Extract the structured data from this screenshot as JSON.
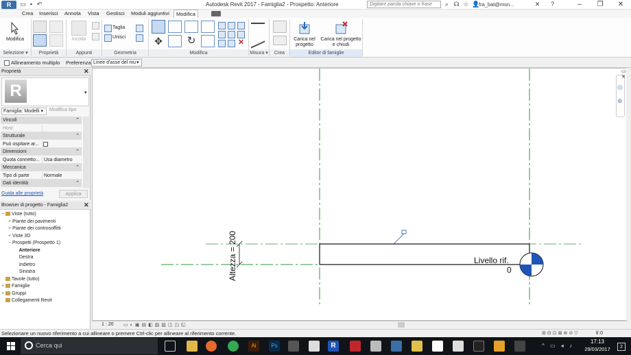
{
  "titlebar": {
    "app_letter": "R",
    "title": "Autodesk Revit 2017 -    Famiglia2 - Prospetto: Anteriore",
    "search_placeholder": "Digitare parola chiave o frase",
    "user": "fra_bat@msn...",
    "help": "?"
  },
  "tabs": [
    "Crea",
    "Inserisci",
    "Annota",
    "Vista",
    "Gestisci",
    "Moduli aggiuntivi",
    "Modifica"
  ],
  "active_tab": "Modifica",
  "ribbon": {
    "modifica": "Modifica",
    "incolla": "Incolla",
    "taglia": "Taglia",
    "unisci": "Unisci",
    "carica_progetto": "Carica nel progetto",
    "carica_chiudi": "Carica nel progetto e chiudi",
    "panels": {
      "selezione": "Selezione",
      "proprieta": "Proprietà",
      "appunti": "Appunti",
      "geometria": "Geometria",
      "modifica": "Modifica",
      "misura": "Misura",
      "crea": "Crea",
      "editor": "Editor di famiglie"
    }
  },
  "optionbar": {
    "allineamento": "Allineamento multiplo",
    "preferenza_label": "Preferenza:",
    "preferenza_value": "Linee d'asse del mu"
  },
  "properties": {
    "title": "Proprietà",
    "type_selector": "Famiglia: Modelli",
    "modifica_tipo": "Modifica tipo",
    "rows": [
      {
        "cat": true,
        "name": "Vincoli",
        "value": ""
      },
      {
        "cat": false,
        "name": "Host",
        "value": "",
        "muted": true
      },
      {
        "cat": true,
        "name": "Strutturale",
        "value": ""
      },
      {
        "cat": false,
        "name": "Può ospitare ar...",
        "value": "",
        "checkbox": true
      },
      {
        "cat": true,
        "name": "Dimensioni",
        "value": ""
      },
      {
        "cat": false,
        "name": "Quota connetto...",
        "value": "Usa diametro"
      },
      {
        "cat": true,
        "name": "Meccanica",
        "value": ""
      },
      {
        "cat": false,
        "name": "Tipo di parte",
        "value": "Normale"
      },
      {
        "cat": true,
        "name": "Dati identità",
        "value": ""
      }
    ],
    "guide_link": "Guida alle proprietà",
    "apply": "Applica"
  },
  "browser": {
    "title": "Browser di progetto - Famiglia2",
    "items": [
      {
        "label": "Viste (tutto)",
        "indent": 0,
        "exp": "−",
        "icon": true
      },
      {
        "label": "Piante dei pavimenti",
        "indent": 1,
        "exp": "+"
      },
      {
        "label": "Piante dei controsoffitti",
        "indent": 1,
        "exp": "+"
      },
      {
        "label": "Viste 3D",
        "indent": 1,
        "exp": "+"
      },
      {
        "label": "Prospetti (Prospetto 1)",
        "indent": 1,
        "exp": "−"
      },
      {
        "label": "Anteriore",
        "indent": 2,
        "exp": "",
        "bold": true
      },
      {
        "label": "Destra",
        "indent": 2,
        "exp": ""
      },
      {
        "label": "Indietro",
        "indent": 2,
        "exp": ""
      },
      {
        "label": "Sinistra",
        "indent": 2,
        "exp": ""
      },
      {
        "label": "Tavole (tutto)",
        "indent": 0,
        "exp": "",
        "icon": true
      },
      {
        "label": "Famiglie",
        "indent": 0,
        "exp": "+",
        "icon": true
      },
      {
        "label": "Gruppi",
        "indent": 0,
        "exp": "+",
        "icon": true
      },
      {
        "label": "Collegamenti Revit",
        "indent": 0,
        "exp": "",
        "icon": true
      }
    ]
  },
  "canvas": {
    "dimension_label": "Altezza = 200",
    "level_name": "Livello rif.",
    "level_value": "0"
  },
  "viewbar": {
    "scale": "1 : 20"
  },
  "status": {
    "message": "Selezionare un nuovo riferimento a cui allineare o premere Ctrl-clic per allineare al riferimento corrente."
  },
  "taskbar": {
    "search": "Cerca qui",
    "time": "17:13",
    "date": "29/03/2017",
    "notif": "2"
  },
  "colors": {
    "accent": "#3c6fa8",
    "refplane": "#2e9a3a",
    "level_blue": "#1f55b5",
    "taskbar": "#101418"
  }
}
